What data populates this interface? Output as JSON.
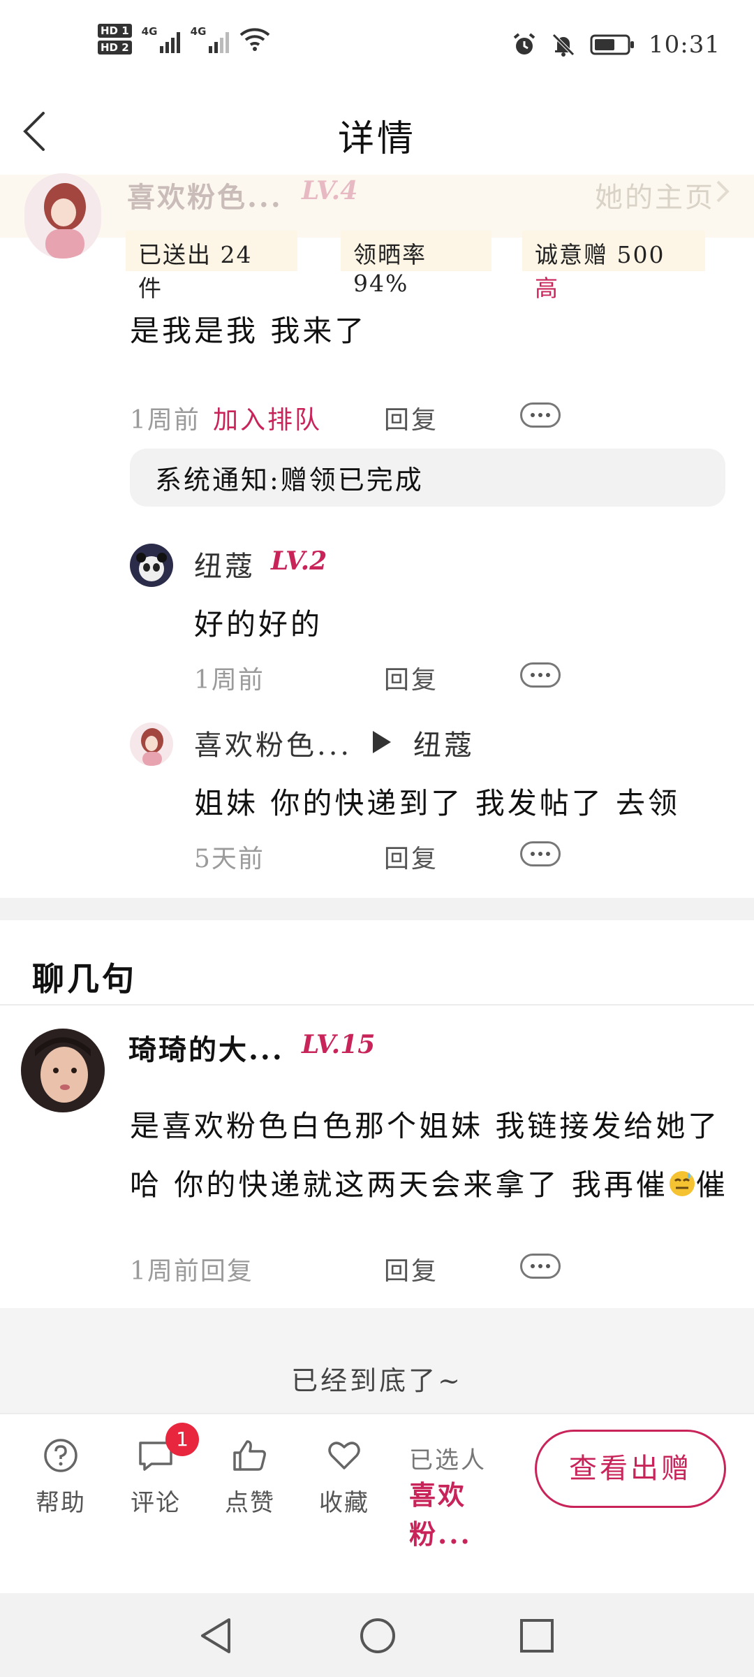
{
  "status_bar": {
    "sim1": "1",
    "sim2": "2",
    "net1": "4G",
    "net2": "4G",
    "time": "10:31"
  },
  "header": {
    "title": "详情"
  },
  "post_author": {
    "name": "喜欢粉色...",
    "level": "LV.4",
    "home_link": "她的主页",
    "stats": {
      "sent_label": "已送出",
      "sent_value": "24",
      "sent_unit": "件",
      "rate_label": "领晒率",
      "rate_value": "94%",
      "sincere_label": "诚意赠",
      "sincere_value": "500",
      "sincere_level": "高"
    }
  },
  "comment1": {
    "text": "是我是我  我来了",
    "time": "1周前",
    "join_queue": "加入排队",
    "reply": "回复",
    "system_note": "系统通知:赠领已完成",
    "replies": [
      {
        "name": "纽蔻",
        "level": "LV.2",
        "text": "好的好的",
        "time": "1周前",
        "reply": "回复"
      },
      {
        "name": "喜欢粉色...",
        "to": "纽蔻",
        "text": "姐妹  你的快递到了   我发帖了  去领",
        "time": "5天前",
        "reply": "回复"
      }
    ]
  },
  "chat_section": {
    "title": "聊几句",
    "comment": {
      "name": "琦琦的大...",
      "level": "LV.15",
      "line1": "是喜欢粉色白色那个姐妹  我链接发给她了",
      "line2a": "哈   你的快递就这两天会来拿了  我再催",
      "line2b": "催",
      "time": "1周前回复",
      "reply": "回复"
    }
  },
  "end_text": "已经到底了~",
  "bottom_bar": {
    "help": "帮助",
    "comment": "评论",
    "comment_badge": "1",
    "like": "点赞",
    "favorite": "收藏",
    "selected_label": "已选人",
    "selected_name": "喜欢粉...",
    "view_button": "查看出赠"
  },
  "colors": {
    "accent": "#c8245a",
    "band_bg": "#fdf6e6",
    "badge": "#e8273f"
  }
}
